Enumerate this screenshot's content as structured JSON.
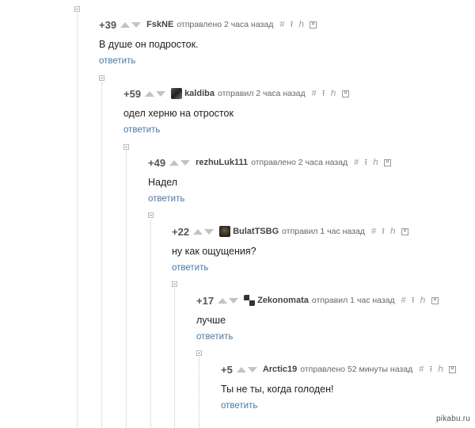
{
  "comments": [
    {
      "rating": "+39",
      "author": "FskNE",
      "meta": "отправлено 2 часа назад",
      "text": "В душе он подросток.",
      "reply": "ответить",
      "avatar": "none"
    },
    {
      "rating": "+59",
      "author": "kaldiba",
      "meta": "отправил 2 часа назад",
      "text": "одел херню на отросток",
      "reply": "ответить",
      "avatar": "user-avatar"
    },
    {
      "rating": "+49",
      "author": "rezhuLuk111",
      "meta": "отправлено 2 часа назад",
      "text": "Надел",
      "reply": "ответить",
      "avatar": "none"
    },
    {
      "rating": "+22",
      "author": "BulatTSBG",
      "meta": "отправил 1 час назад",
      "text": "ну как ощущения?",
      "reply": "ответить",
      "avatar": "user-avatar"
    },
    {
      "rating": "+17",
      "author": "Zekonomata",
      "meta": "отправил 1 час назад",
      "text": "лучше",
      "reply": "ответить",
      "avatar": "user-avatar"
    },
    {
      "rating": "+5",
      "author": "Arctic19",
      "meta": "отправлено 52 минуты назад",
      "text": "Ты не ты, когда голоден!",
      "reply": "ответить",
      "avatar": "none"
    }
  ],
  "tools": {
    "hash": "#",
    "link": "⭱",
    "branch": "ℎ",
    "save_icon": "floppy-disk-icon"
  },
  "icons": {
    "upvote": "arrow-up-icon",
    "downvote": "arrow-down-icon",
    "collapse": "collapse-toggle-icon",
    "link": "link-icon",
    "branch": "branch-icon"
  },
  "colors": {
    "reply_link": "#4a77a3",
    "rating": "#555555",
    "vote_arrows": "#c3c3c3"
  },
  "watermark": "pikabu.ru"
}
